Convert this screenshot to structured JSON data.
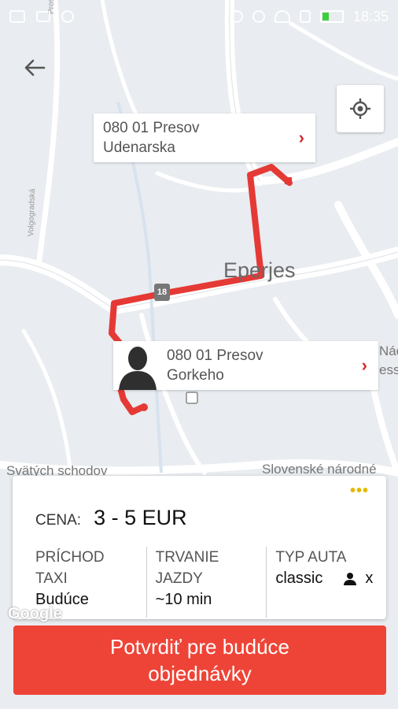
{
  "status_bar": {
    "time": "18:35"
  },
  "map": {
    "city_label": "Eperjes",
    "road_shield": "18",
    "labels": {
      "svatich": "Svätých schodov",
      "slovenske": "Slovenské národné",
      "nado": "Nádo",
      "essy": "essy",
      "vologradska": "Volgogradská",
      "prostejovska": "Prostějovská"
    },
    "colors": {
      "route": "#e53935",
      "road": "#ffffff",
      "background": "#e9ecf0"
    }
  },
  "back_icon": "back-arrow-icon",
  "locate_icon": "my-location-icon",
  "destination": {
    "line1": "080 01 Presov",
    "line2": "Udenarska"
  },
  "origin": {
    "line1": "080 01 Presov",
    "line2": "Gorkeho"
  },
  "card": {
    "more": "•••",
    "price_label": "CENA:",
    "price_value": "3 - 5 EUR",
    "arrival_label_1": "PRÍCHOD",
    "arrival_label_2": "TAXI",
    "arrival_value": "Budúce",
    "duration_label_1": "TRVANIE",
    "duration_label_2": "JAZDY",
    "duration_value": "~10 min",
    "car_label": "TYP AUTA",
    "car_value": "classic",
    "car_extra": "x"
  },
  "google_logo": "Google",
  "confirm_button": {
    "line1": "Potvrdiť pre budúce",
    "line2": "objednávky"
  }
}
